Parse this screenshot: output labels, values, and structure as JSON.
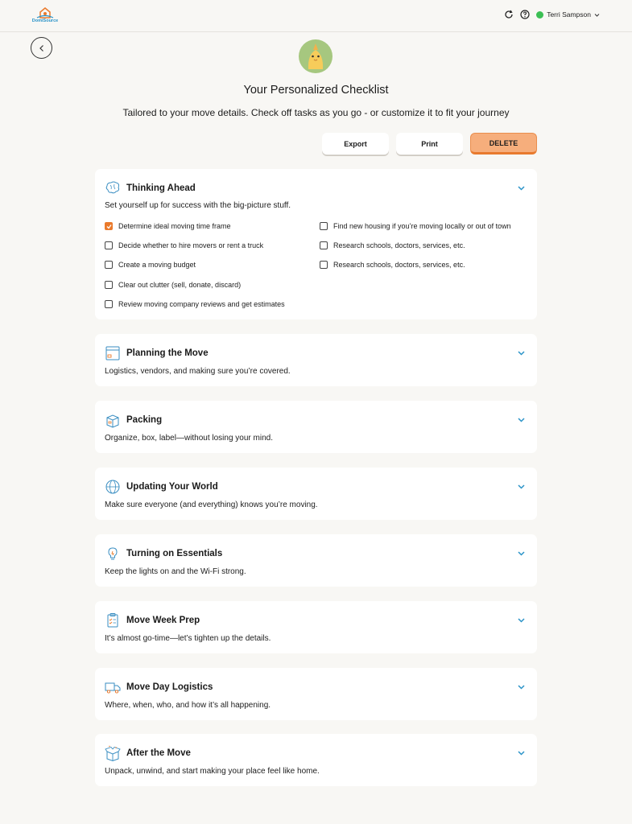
{
  "header": {
    "logo_text": "DomiSource",
    "user_name": "Terri Sampson"
  },
  "page": {
    "title": "Your Personalized Checklist",
    "subtitle": "Tailored to your move details. Check off tasks as you go - or customize it to fit your journey"
  },
  "actions": {
    "export": "Export",
    "print": "Print",
    "delete": "DELETE"
  },
  "sections": [
    {
      "title": "Thinking Ahead",
      "description": "Set yourself up for success with the big-picture stuff.",
      "icon": "brain-icon",
      "tasks_left": [
        {
          "label": "Determine ideal moving time frame",
          "checked": true
        },
        {
          "label": "Decide whether to hire movers or rent a truck",
          "checked": false
        },
        {
          "label": "Create a moving budget",
          "checked": false
        },
        {
          "label": "Clear out clutter (sell, donate, discard)",
          "checked": false
        },
        {
          "label": "Review moving company reviews and get estimates",
          "checked": false
        }
      ],
      "tasks_right": [
        {
          "label": "Find new housing if you’re moving locally or out of town",
          "checked": false
        },
        {
          "label": "Research schools, doctors, services, etc.",
          "checked": false
        },
        {
          "label": "Research schools, doctors, services, etc.",
          "checked": false
        }
      ]
    },
    {
      "title": "Planning the Move",
      "description": "Logistics, vendors, and making sure you’re covered.",
      "icon": "calendar-box-icon"
    },
    {
      "title": "Packing",
      "description": "Organize, box, label—without losing your mind.",
      "icon": "box-icon"
    },
    {
      "title": "Updating Your World",
      "description": "Make sure everyone (and everything) knows you’re moving.",
      "icon": "globe-icon"
    },
    {
      "title": "Turning on Essentials",
      "description": "Keep the lights on and the Wi-Fi strong.",
      "icon": "lightbulb-icon"
    },
    {
      "title": "Move Week Prep",
      "description": "It’s almost go-time—let’s tighten up the details.",
      "icon": "clipboard-icon"
    },
    {
      "title": "Move Day Logistics",
      "description": "Where, when, who, and how it’s all happening.",
      "icon": "truck-icon"
    },
    {
      "title": "After the Move",
      "description": "Unpack, unwind, and start making your place feel like home.",
      "icon": "open-box-icon"
    }
  ],
  "colors": {
    "accent": "#ea7a2c",
    "delete_bg": "#f6ae7c",
    "chevron": "#2a93c8",
    "status": "#3cbf54",
    "background": "#f8f7f4"
  }
}
